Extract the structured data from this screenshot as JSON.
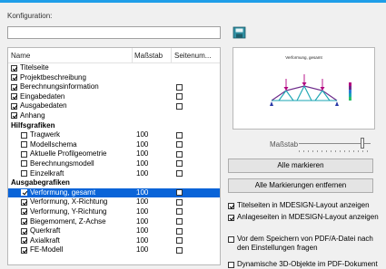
{
  "konfiguration": {
    "label": "Konfiguration:",
    "value": ""
  },
  "table": {
    "headers": {
      "name": "Name",
      "scale": "Maßstab",
      "page": "Seitenum..."
    },
    "rows": [
      {
        "type": "item",
        "label": "Titelseite",
        "checked": true,
        "indent": 0,
        "value": "",
        "pagebox": false
      },
      {
        "type": "item",
        "label": "Projektbeschreibung",
        "checked": true,
        "indent": 0,
        "value": "",
        "pagebox": false
      },
      {
        "type": "item",
        "label": "Berechnungsinformation",
        "checked": true,
        "indent": 0,
        "value": "",
        "pagebox": true
      },
      {
        "type": "item",
        "label": "Eingabedaten",
        "checked": true,
        "indent": 0,
        "value": "",
        "pagebox": true
      },
      {
        "type": "item",
        "label": "Ausgabedaten",
        "checked": true,
        "indent": 0,
        "value": "",
        "pagebox": true
      },
      {
        "type": "item",
        "label": "Anhang",
        "checked": true,
        "indent": 0,
        "value": "",
        "pagebox": false
      },
      {
        "type": "group",
        "label": "Hilfsgrafiken"
      },
      {
        "type": "item",
        "label": "Tragwerk",
        "checked": false,
        "indent": 1,
        "value": "100",
        "pagebox": true
      },
      {
        "type": "item",
        "label": "Modellschema",
        "checked": false,
        "indent": 1,
        "value": "100",
        "pagebox": true
      },
      {
        "type": "item",
        "label": "Aktuelle Profilgeometrie",
        "checked": false,
        "indent": 1,
        "value": "100",
        "pagebox": true
      },
      {
        "type": "item",
        "label": "Berechnungsmodell",
        "checked": false,
        "indent": 1,
        "value": "100",
        "pagebox": true
      },
      {
        "type": "item",
        "label": "Einzelkraft",
        "checked": false,
        "indent": 1,
        "value": "100",
        "pagebox": true
      },
      {
        "type": "group",
        "label": "Ausgabegrafiken"
      },
      {
        "type": "item",
        "label": "Verformung, gesamt",
        "checked": true,
        "indent": 1,
        "value": "100",
        "pagebox": true,
        "selected": true
      },
      {
        "type": "item",
        "label": "Verformung, X-Richtung",
        "checked": true,
        "indent": 1,
        "value": "100",
        "pagebox": true
      },
      {
        "type": "item",
        "label": "Verformung, Y-Richtung",
        "checked": true,
        "indent": 1,
        "value": "100",
        "pagebox": true
      },
      {
        "type": "item",
        "label": "Biegemoment, Z-Achse",
        "checked": true,
        "indent": 1,
        "value": "100",
        "pagebox": true
      },
      {
        "type": "item",
        "label": "Querkraft",
        "checked": true,
        "indent": 1,
        "value": "100",
        "pagebox": true
      },
      {
        "type": "item",
        "label": "Axialkraft",
        "checked": true,
        "indent": 1,
        "value": "100",
        "pagebox": true
      },
      {
        "type": "item",
        "label": "FE-Modell",
        "checked": true,
        "indent": 1,
        "value": "100",
        "pagebox": true
      }
    ]
  },
  "preview": {
    "title": "Verformung, gesamt"
  },
  "scale": {
    "label": "Maßstab",
    "level": 0.88
  },
  "buttons": {
    "mark_all": "Alle markieren",
    "unmark_all": "Alle Markierungen entfernen"
  },
  "options": [
    {
      "label": "Titelseiten in MDESIGN-Layout anzeigen",
      "checked": true
    },
    {
      "label": "Anlageseiten in MDESIGN-Layout anzeigen",
      "checked": true
    },
    {
      "label": "Vor dem Speichern von PDF/A-Datei nach den Einstellungen fragen",
      "checked": false
    },
    {
      "label": "Dynamische 3D-Objekte im PDF-Dokument",
      "checked": false
    }
  ],
  "colors": {
    "accent": "#1f9ee8",
    "selection": "#0a64d8"
  }
}
